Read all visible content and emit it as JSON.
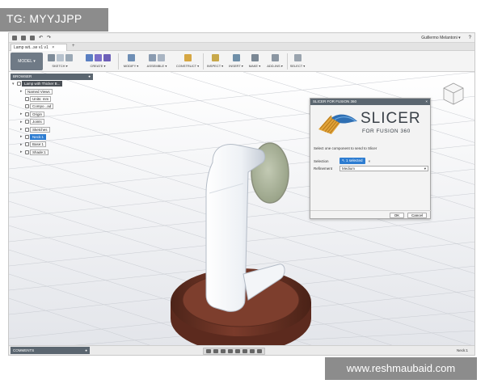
{
  "overlay": {
    "tag_text": "TG: MYYJJPP",
    "watermark": "www.reshmaubaid.com"
  },
  "titlebar": {
    "user": "Guillermo Melantoni ▾"
  },
  "tab": {
    "label": "Lamp wit...se v1 v1",
    "close": "×",
    "add": "+"
  },
  "toolbar": {
    "model_label": "MODEL ▾",
    "groups": [
      "SKETCH ▾",
      "CREATE ▾",
      "MODIFY ▾",
      "ASSEMBLE ▾",
      "CONSTRUCT ▾",
      "INSPECT ▾",
      "INSERT ▾",
      "MAKE ▾",
      "ADD-INS ▾",
      "SELECT ▾"
    ]
  },
  "browser": {
    "title": "BROWSER",
    "items": [
      {
        "label": "Lamp with Thicker B...",
        "kind": "root"
      },
      {
        "label": "Named Views",
        "kind": "plain"
      },
      {
        "label": "Units: mm",
        "kind": "plain"
      },
      {
        "label": "Compo...ad",
        "kind": "plain"
      },
      {
        "label": "Origin",
        "kind": "plain"
      },
      {
        "label": "Joints",
        "kind": "plain"
      },
      {
        "label": "Sketches",
        "kind": "plain"
      },
      {
        "label": "Neck:1",
        "kind": "selected"
      },
      {
        "label": "Base:1",
        "kind": "plain"
      },
      {
        "label": "Shade:1",
        "kind": "plain"
      }
    ]
  },
  "dialog": {
    "title": "SLICER FOR FUSION 360",
    "logo_main": "SLICER",
    "logo_sub": "FOR FUSION 360",
    "instruction": "Select one component to send to Slicer",
    "selection_label": "Selection",
    "selection_value": "1 selected",
    "refinement_label": "Refinement",
    "refinement_value": "Medium",
    "ok": "OK",
    "cancel": "Cancel"
  },
  "statusbar": {
    "comments": "COMMENTS",
    "selection": "Neck:1"
  },
  "colors": {
    "grid": "#c9ccd2",
    "panel_header": "#5b6670",
    "accent": "#2e7dd1",
    "base_wood": "#6b3325",
    "lamp_body": "#eef1f6",
    "lamp_shade": "#b7bfa6"
  }
}
